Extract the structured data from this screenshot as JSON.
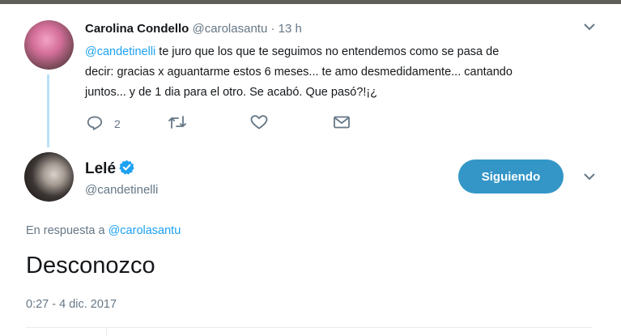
{
  "tweet": {
    "author_name": "Carolina Condello",
    "author_handle": "@carolasantu",
    "time_sep": " · ",
    "time": "13 h",
    "mention": "@candetinelli",
    "text_line1_rest": " te juro que los que te seguimos no entendemos como se pasa de",
    "text_line2": "decir: gracias x aguantarme estos 6 meses... te amo desmedidamente... cantando",
    "text_line3": "juntos... y de 1 dia para el otro. Se acabó. Que pasó?!¡¿",
    "reply_count": "2"
  },
  "reply": {
    "author_name": "Lelé",
    "author_handle": "@candetinelli",
    "follow_label": "Siguiendo",
    "reply_prefix": "En respuesta a ",
    "reply_handle": "@carolasantu",
    "text": "Desconozco",
    "timestamp": "0:27 - 4 dic. 2017"
  },
  "colors": {
    "accent": "#1da1f2",
    "button": "#3396c7",
    "muted": "#657786",
    "thread_line": "#b9e1f6"
  },
  "icons": [
    "reply-icon",
    "retweet-icon",
    "like-icon",
    "dm-icon",
    "verified-icon",
    "chevron-down-icon"
  ]
}
